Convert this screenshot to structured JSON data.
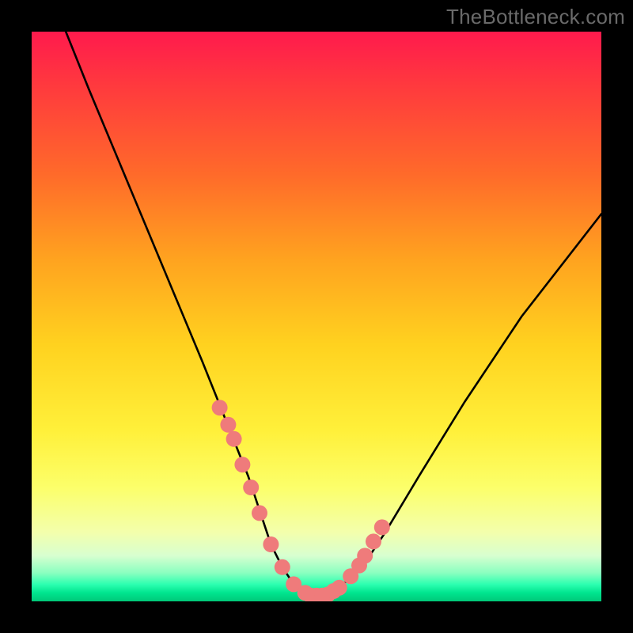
{
  "watermark": "TheBottleneck.com",
  "chart_data": {
    "type": "line",
    "title": "",
    "xlabel": "",
    "ylabel": "",
    "xlim": [
      0,
      100
    ],
    "ylim": [
      0,
      100
    ],
    "grid": false,
    "legend": false,
    "series": [
      {
        "name": "bottleneck-curve",
        "color": "#000000",
        "x": [
          6,
          10,
          15,
          20,
          25,
          30,
          34,
          36,
          38,
          40,
          42,
          44,
          46,
          48,
          50,
          52,
          54,
          58,
          62,
          68,
          76,
          86,
          100
        ],
        "y": [
          100,
          90,
          78,
          66,
          54,
          42,
          32,
          27,
          22,
          16,
          10,
          6,
          3,
          1.5,
          1,
          1.2,
          2.4,
          6,
          12,
          22,
          35,
          50,
          68
        ]
      }
    ],
    "markers": [
      {
        "name": "highlighted-points",
        "color": "#ef7b7b",
        "radius_px": 10,
        "x": [
          33,
          34.5,
          35.5,
          37,
          38.5,
          40,
          42,
          44,
          46,
          48,
          49,
          50,
          51,
          52,
          53,
          54,
          56,
          57.5,
          58.5,
          60,
          61.5
        ],
        "y": [
          34,
          31,
          28.5,
          24,
          20,
          15.5,
          10,
          6,
          3,
          1.5,
          1,
          1,
          1,
          1.2,
          1.8,
          2.4,
          4.4,
          6.3,
          8,
          10.5,
          13
        ]
      }
    ],
    "background_gradient": {
      "stops": [
        {
          "pos": 0.0,
          "color": "#ff1a4d"
        },
        {
          "pos": 0.55,
          "color": "#ffd21f"
        },
        {
          "pos": 0.92,
          "color": "#d7ffd0"
        },
        {
          "pos": 1.0,
          "color": "#00c878"
        }
      ]
    }
  }
}
